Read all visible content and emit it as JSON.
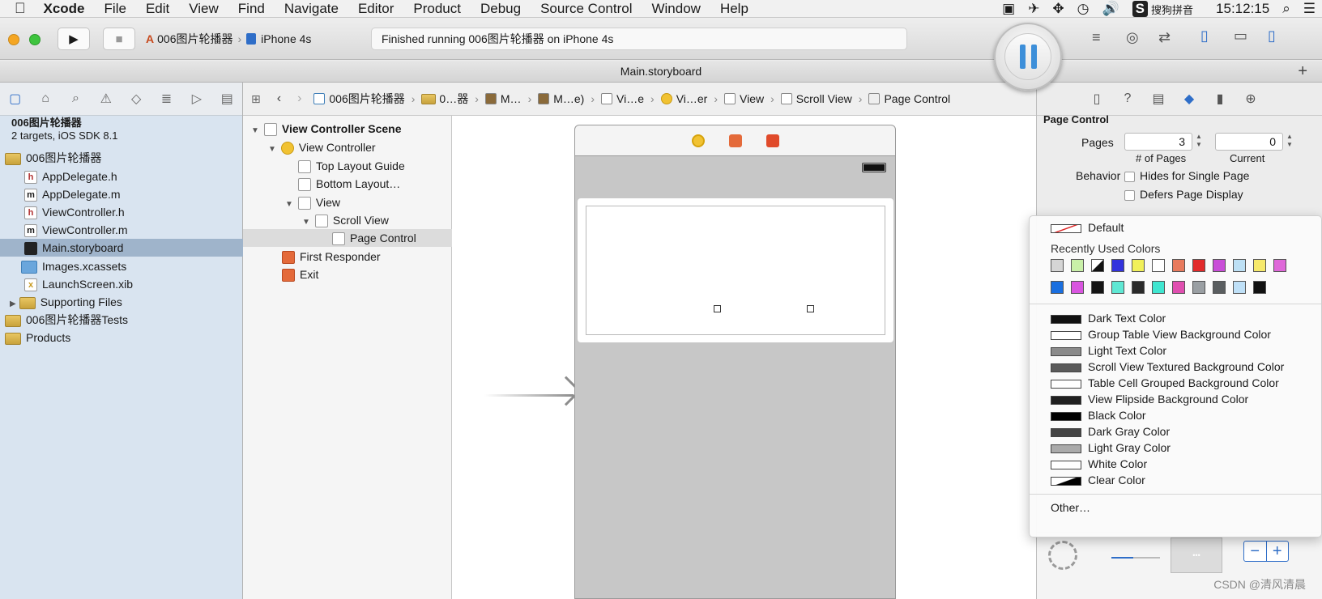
{
  "menubar": {
    "apple": "",
    "app": "Xcode",
    "items": [
      "File",
      "Edit",
      "View",
      "Find",
      "Navigate",
      "Editor",
      "Product",
      "Debug",
      "Source Control",
      "Window",
      "Help"
    ],
    "ime": "搜狗拼音",
    "time": "15:12:15"
  },
  "toolbar": {
    "project": "006图片轮播器",
    "device": "iPhone 4s",
    "status": "Finished running 006图片轮播器 on iPhone 4s"
  },
  "tab": {
    "title": "Main.storyboard"
  },
  "navigator": {
    "project": {
      "name": "006图片轮播器",
      "subtitle": "2 targets, iOS SDK 8.1"
    },
    "items": [
      {
        "label": "006图片轮播器",
        "kind": "folder",
        "icon": "folder-icon"
      },
      {
        "label": "AppDelegate.h",
        "kind": "h",
        "icon": "header-file-icon"
      },
      {
        "label": "AppDelegate.m",
        "kind": "m",
        "icon": "impl-file-icon"
      },
      {
        "label": "ViewController.h",
        "kind": "h",
        "icon": "header-file-icon"
      },
      {
        "label": "ViewController.m",
        "kind": "m",
        "icon": "impl-file-icon"
      },
      {
        "label": "Main.storyboard",
        "kind": "sb",
        "icon": "storyboard-icon",
        "selected": true
      },
      {
        "label": "Images.xcassets",
        "kind": "xa",
        "icon": "asset-catalog-icon"
      },
      {
        "label": "LaunchScreen.xib",
        "kind": "xib",
        "icon": "xib-file-icon"
      },
      {
        "label": "Supporting Files",
        "kind": "folder",
        "icon": "folder-icon"
      },
      {
        "label": "006图片轮播器Tests",
        "kind": "folder",
        "icon": "folder-icon"
      },
      {
        "label": "Products",
        "kind": "folder",
        "icon": "folder-icon"
      }
    ]
  },
  "jumpbar": {
    "items": [
      "006图片轮播器",
      "0…器",
      "M…",
      "M…e)",
      "Vi…e",
      "Vi…er",
      "View",
      "Scroll View",
      "Page Control"
    ]
  },
  "outline": {
    "items": [
      {
        "label": "View Controller Scene"
      },
      {
        "label": "View Controller"
      },
      {
        "label": "Top Layout Guide"
      },
      {
        "label": "Bottom Layout…"
      },
      {
        "label": "View"
      },
      {
        "label": "Scroll View"
      },
      {
        "label": "Page Control"
      },
      {
        "label": "First Responder"
      },
      {
        "label": "Exit"
      }
    ]
  },
  "inspector": {
    "section": "Page Control",
    "pages_label": "Pages",
    "pages_value": "3",
    "pages_caption": "# of Pages",
    "current_value": "0",
    "current_caption": "Current",
    "behavior_label": "Behavior",
    "hides_label": "Hides for Single Page",
    "defers_label": "Defers Page Display"
  },
  "color_popup": {
    "default": "Default",
    "recent_title": "Recently Used Colors",
    "recent_row1": [
      "#d5d5d5",
      "#c9f0a8",
      "#1c1c1c",
      "#3333dd",
      "#f1f05a",
      "#ffffff",
      "#e87a5d",
      "#e22b2b",
      "#c94ed8",
      "#bde0f5",
      "#f6e96b",
      "#df68d9"
    ],
    "recent_row2": [
      "#1a6fe0",
      "#d955e0",
      "#141414",
      "#5fe8d4",
      "#2a2a2a",
      "#3fe6d0",
      "#e04fb0",
      "#9a9fa3",
      "#5a5e60",
      "#bfe0f7",
      "#111111"
    ],
    "named": [
      {
        "label": "Dark Text Color",
        "color": "#111111"
      },
      {
        "label": "Group Table View Background Color",
        "color": "#ffffff"
      },
      {
        "label": "Light Text Color",
        "color": "#8a8a8a"
      },
      {
        "label": "Scroll View Textured Background Color",
        "color": "#5a5a5a"
      },
      {
        "label": "Table Cell Grouped Background Color",
        "color": "#ffffff"
      },
      {
        "label": "View Flipside Background Color",
        "color": "#1f1f1f"
      },
      {
        "label": "Black Color",
        "color": "#000000"
      },
      {
        "label": "Dark Gray Color",
        "color": "#444444"
      },
      {
        "label": "Light Gray Color",
        "color": "#aaaaaa"
      },
      {
        "label": "White Color",
        "color": "#ffffff"
      },
      {
        "label": "Clear Color",
        "color": "#000000"
      }
    ],
    "other": "Other…"
  },
  "library": {
    "minus": "−",
    "plus": "+"
  },
  "watermark": "CSDN @清风清晨"
}
